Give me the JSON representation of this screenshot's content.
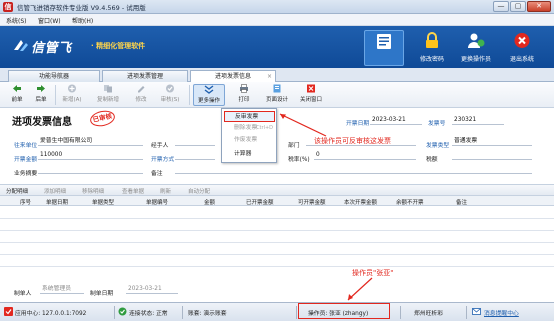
{
  "window": {
    "title": "信管飞进销存软件专业版 V9.4.569 - 试用版",
    "controls": [
      "—",
      "▢",
      "✕"
    ]
  },
  "menu": [
    "系统(S)",
    "窗口(W)",
    "帮助(H)"
  ],
  "brand": {
    "name": "信管飞",
    "tagline": "· 精细化管理软件"
  },
  "header_buttons": [
    {
      "label": "",
      "icon": "document-list-icon"
    },
    {
      "label": "修改密码",
      "icon": "lock-icon"
    },
    {
      "label": "更换操作员",
      "icon": "change-user-icon"
    },
    {
      "label": "退出系统",
      "icon": "exit-icon"
    }
  ],
  "tabs": [
    {
      "label": "功能导航器"
    },
    {
      "label": "进项发票管理"
    },
    {
      "label": "进项发票信息"
    }
  ],
  "toolbar": [
    {
      "label": "前单",
      "icon": "arrow-left-icon",
      "enabled": true
    },
    {
      "label": "后单",
      "icon": "arrow-right-icon",
      "enabled": true
    },
    {
      "label": "新增(A)",
      "icon": "add-icon",
      "enabled": false
    },
    {
      "label": "复制新增",
      "icon": "copy-icon",
      "enabled": false
    },
    {
      "label": "修改",
      "icon": "edit-icon",
      "enabled": false
    },
    {
      "label": "审核(S)",
      "icon": "audit-icon",
      "enabled": false
    },
    {
      "label": "更多操作",
      "icon": "more-icon",
      "enabled": true
    },
    {
      "label": "打印",
      "icon": "print-icon",
      "enabled": true
    },
    {
      "label": "页面设计",
      "icon": "design-icon",
      "enabled": true
    },
    {
      "label": "关闭窗口",
      "icon": "close-window-icon",
      "enabled": true
    }
  ],
  "dropdown": [
    {
      "label": "反审发票",
      "enabled": true,
      "shortcut": ""
    },
    {
      "label": "删除发票",
      "enabled": false,
      "shortcut": "Ctrl+D"
    },
    {
      "label": "作废发票",
      "enabled": false,
      "shortcut": ""
    },
    {
      "label": "计算器",
      "enabled": true,
      "shortcut": ""
    }
  ],
  "form": {
    "title": "进项发票信息",
    "stamp": "已审核",
    "date_label": "开票日期",
    "date_value": "2023-03-21",
    "no_label": "发票号",
    "no_value": "230321",
    "supplier_label": "往来单位",
    "supplier_value": "爱普生中国有限公司",
    "handler_label": "经手人",
    "handler_value": "",
    "dept_label": "部门",
    "dept_value": "",
    "type_label": "发票类型",
    "type_value": "普通发票",
    "amount_label": "开票金额",
    "amount_value": "110000",
    "method_label": "开票方式",
    "method_value": "",
    "taxrate_label": "税率(%)",
    "taxrate_value": "0",
    "tax_label": "税额",
    "tax_value": "",
    "summary_label": "业务摘要",
    "summary_value": "",
    "remark_label": "备注",
    "remark_value": ""
  },
  "annotations": {
    "can_unaudit": "该操作员可反审核这发票",
    "operator": "操作员\"张亚\""
  },
  "detail_bar": {
    "title": "分配明细",
    "actions": [
      "添加明细",
      "移除明细",
      "查看单据",
      "刷新",
      "自动分配"
    ]
  },
  "grid_columns": [
    "序号",
    "单据日期",
    "单据类型",
    "单据编号",
    "金额",
    "已开票金额",
    "可开票金额",
    "本次开票金额",
    "余额不开票",
    "备注"
  ],
  "footer": {
    "maker_label": "制单人",
    "maker_value": "系统管理员",
    "make_date_label": "制单日期",
    "make_date_value": "2023-03-21"
  },
  "status": {
    "app_center": "应用中心: 127.0.0.1:7092",
    "connection": "连接状态: 正常",
    "account": "账套: 演示账套",
    "operator": "操作员: 张亚 (zhangy)",
    "company": "郑州旺析彩",
    "messages": "消息提醒中心"
  },
  "colors": {
    "header_blue": "#1f5fae",
    "accent_red": "#e2281f",
    "stamp_red": "#e2281f"
  }
}
